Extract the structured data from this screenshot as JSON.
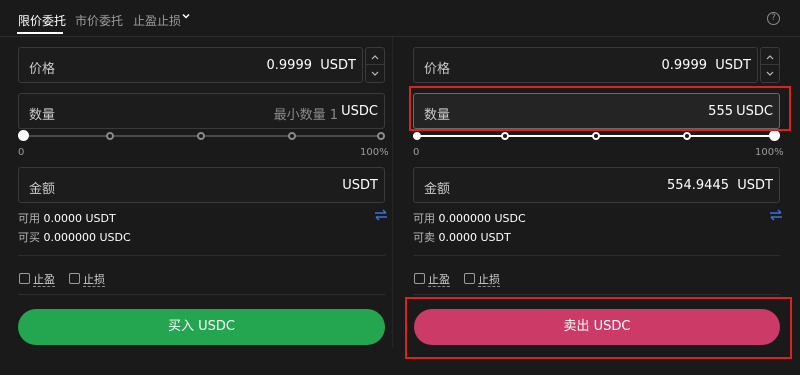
{
  "tabs": [
    {
      "label": "限价委托",
      "active": true
    },
    {
      "label": "市价委托",
      "active": false
    },
    {
      "label": "止盈止损",
      "active": false
    }
  ],
  "help_icon": "?",
  "buy": {
    "price_label": "价格",
    "price_value": "0.9999",
    "price_unit": "USDT",
    "qty_label": "数量",
    "qty_placeholder": "最小数量 1",
    "qty_unit": "USDC",
    "slider_min": "0",
    "slider_max": "100%",
    "slider_level": 0,
    "amount_label": "金额",
    "amount_value": "",
    "amount_unit": "USDT",
    "available_label": "可用",
    "available_value": "0.0000 USDT",
    "buyable_label": "可买",
    "buyable_value": "0.000000 USDC",
    "tp_label": "止盈",
    "sl_label": "止损",
    "button_label": "买入 USDC"
  },
  "sell": {
    "price_label": "价格",
    "price_value": "0.9999",
    "price_unit": "USDT",
    "qty_label": "数量",
    "qty_value": "555",
    "qty_unit": "USDC",
    "slider_min": "0",
    "slider_max": "100%",
    "slider_level": 1,
    "amount_label": "金额",
    "amount_value": "554.9445",
    "amount_unit": "USDT",
    "available_label": "可用",
    "available_value": "0.000000 USDC",
    "sellable_label": "可卖",
    "sellable_value": "0.0000 USDT",
    "tp_label": "止盈",
    "sl_label": "止损",
    "button_label": "卖出 USDC"
  },
  "colors": {
    "buy": "#23a64f",
    "sell": "#cc3a68",
    "highlight": "#e02020",
    "swap_icon": "#3d6fe0"
  },
  "icons": {
    "dropdown": "chevron-down-icon",
    "help": "help-icon",
    "stepper_up": "chevron-up-icon",
    "stepper_down": "chevron-down-icon",
    "swap": "swap-arrows-icon"
  }
}
